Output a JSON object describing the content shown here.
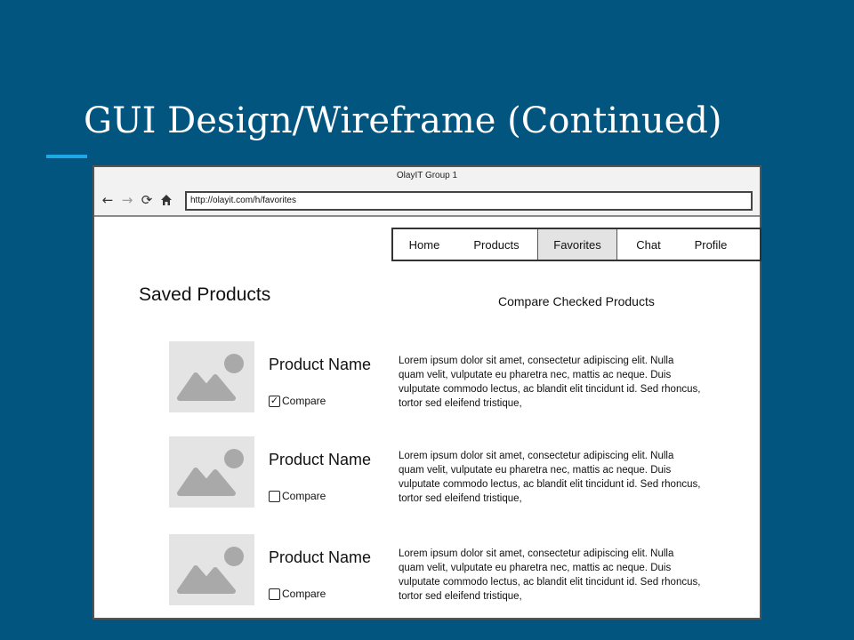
{
  "slide": {
    "title": "GUI Design/Wireframe (Continued)"
  },
  "browser": {
    "window_title": "OlayIT Group 1",
    "url": "http://olayit.com/h/favorites"
  },
  "nav": {
    "tabs": [
      {
        "label": "Home"
      },
      {
        "label": "Products"
      },
      {
        "label": "Favorites",
        "active": true
      },
      {
        "label": "Chat"
      },
      {
        "label": "Profile"
      }
    ]
  },
  "page": {
    "heading": "Saved Products",
    "compare_action": "Compare Checked Products"
  },
  "products": [
    {
      "name": "Product Name",
      "compare_label": "Compare",
      "checked": true,
      "description": "Lorem ipsum dolor sit amet, consectetur adipiscing elit. Nulla quam velit, vulputate eu pharetra nec, mattis ac neque. Duis vulputate commodo lectus, ac blandit elit tincidunt id. Sed rhoncus, tortor sed eleifend tristique,"
    },
    {
      "name": "Product Name",
      "compare_label": "Compare",
      "checked": false,
      "description": "Lorem ipsum dolor sit amet, consectetur adipiscing elit. Nulla quam velit, vulputate eu pharetra nec, mattis ac neque. Duis vulputate commodo lectus, ac blandit elit tincidunt id. Sed rhoncus, tortor sed eleifend tristique,"
    },
    {
      "name": "Product Name",
      "compare_label": "Compare",
      "checked": false,
      "description": "Lorem ipsum dolor sit amet, consectetur adipiscing elit. Nulla quam velit, vulputate eu pharetra nec, mattis ac neque. Duis vulputate commodo lectus, ac blandit elit tincidunt id. Sed rhoncus, tortor sed eleifend tristique,"
    }
  ],
  "icons": {
    "back": "arrow-left-icon",
    "forward": "arrow-right-icon",
    "reload": "reload-icon",
    "home": "home-icon",
    "thumbnail": "image-placeholder-icon"
  },
  "colors": {
    "slide_background": "#02557f",
    "title_accent": "#1fa8e8",
    "active_tab": "#e3e3e3",
    "placeholder": "#a9a9a9"
  }
}
